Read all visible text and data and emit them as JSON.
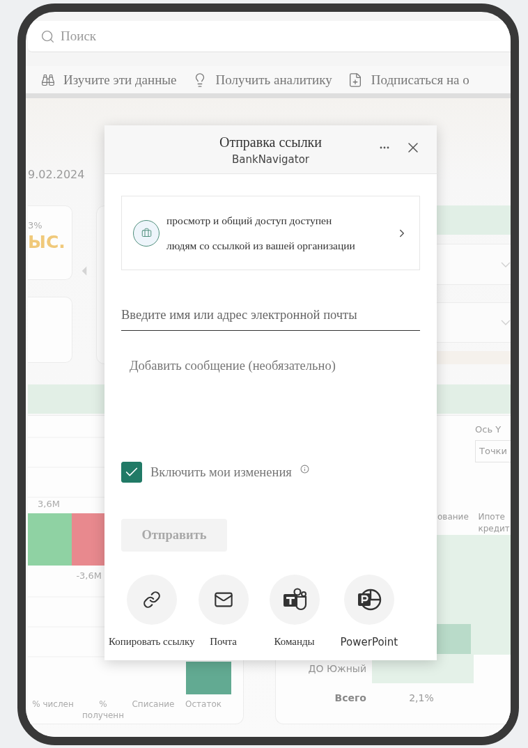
{
  "search": {
    "placeholder": "Поиск"
  },
  "toolbar": [
    {
      "kind": "explore",
      "label": "Изучите эти данные"
    },
    {
      "kind": "insights",
      "label": "Получить аналитику"
    },
    {
      "kind": "subscribe",
      "label": "Подписаться на о"
    }
  ],
  "report": {
    "date": "9.02.2024",
    "kpi": {
      "caption": "3%",
      "value": "ЫС."
    },
    "waterfall": {
      "bars": [
        {
          "kind": "increase",
          "label": "3,6M"
        },
        {
          "kind": "decrease",
          "label": "-3,6M"
        },
        {
          "kind": "total"
        }
      ],
      "categories": [
        "% числен",
        "% полученн",
        "Списание",
        "Остаток"
      ]
    },
    "matrix": {
      "axis_label": "Ось Y",
      "axis_select": "Точки",
      "columns": [
        "ование",
        "Ипоте кредит"
      ],
      "rows": [
        {
          "kind": "region",
          "label": "ДО Южный"
        },
        {
          "kind": "total",
          "label": "Всего",
          "cells": [
            "2,1%"
          ]
        }
      ]
    }
  },
  "dialog": {
    "title": "Отправка ссылки",
    "subtitle": "BankNavigator",
    "access": [
      "просмотр и общий доступ доступен",
      "людям со ссылкой из вашей организации"
    ],
    "recipient": {
      "placeholder": "Введите имя или адрес электронной почты"
    },
    "message": {
      "placeholder": "Добавить сообщение (необязательно)"
    },
    "include_changes": {
      "label": "Включить мои изменения",
      "checked": true
    },
    "send": {
      "label": "Отправить",
      "disabled": true
    },
    "share": [
      {
        "kind": "link",
        "label": "Копировать ссылку"
      },
      {
        "kind": "mail",
        "label": "Почта"
      },
      {
        "kind": "teams",
        "label": "Команды"
      },
      {
        "kind": "powerpoint",
        "label": "PowerPoint"
      }
    ]
  }
}
